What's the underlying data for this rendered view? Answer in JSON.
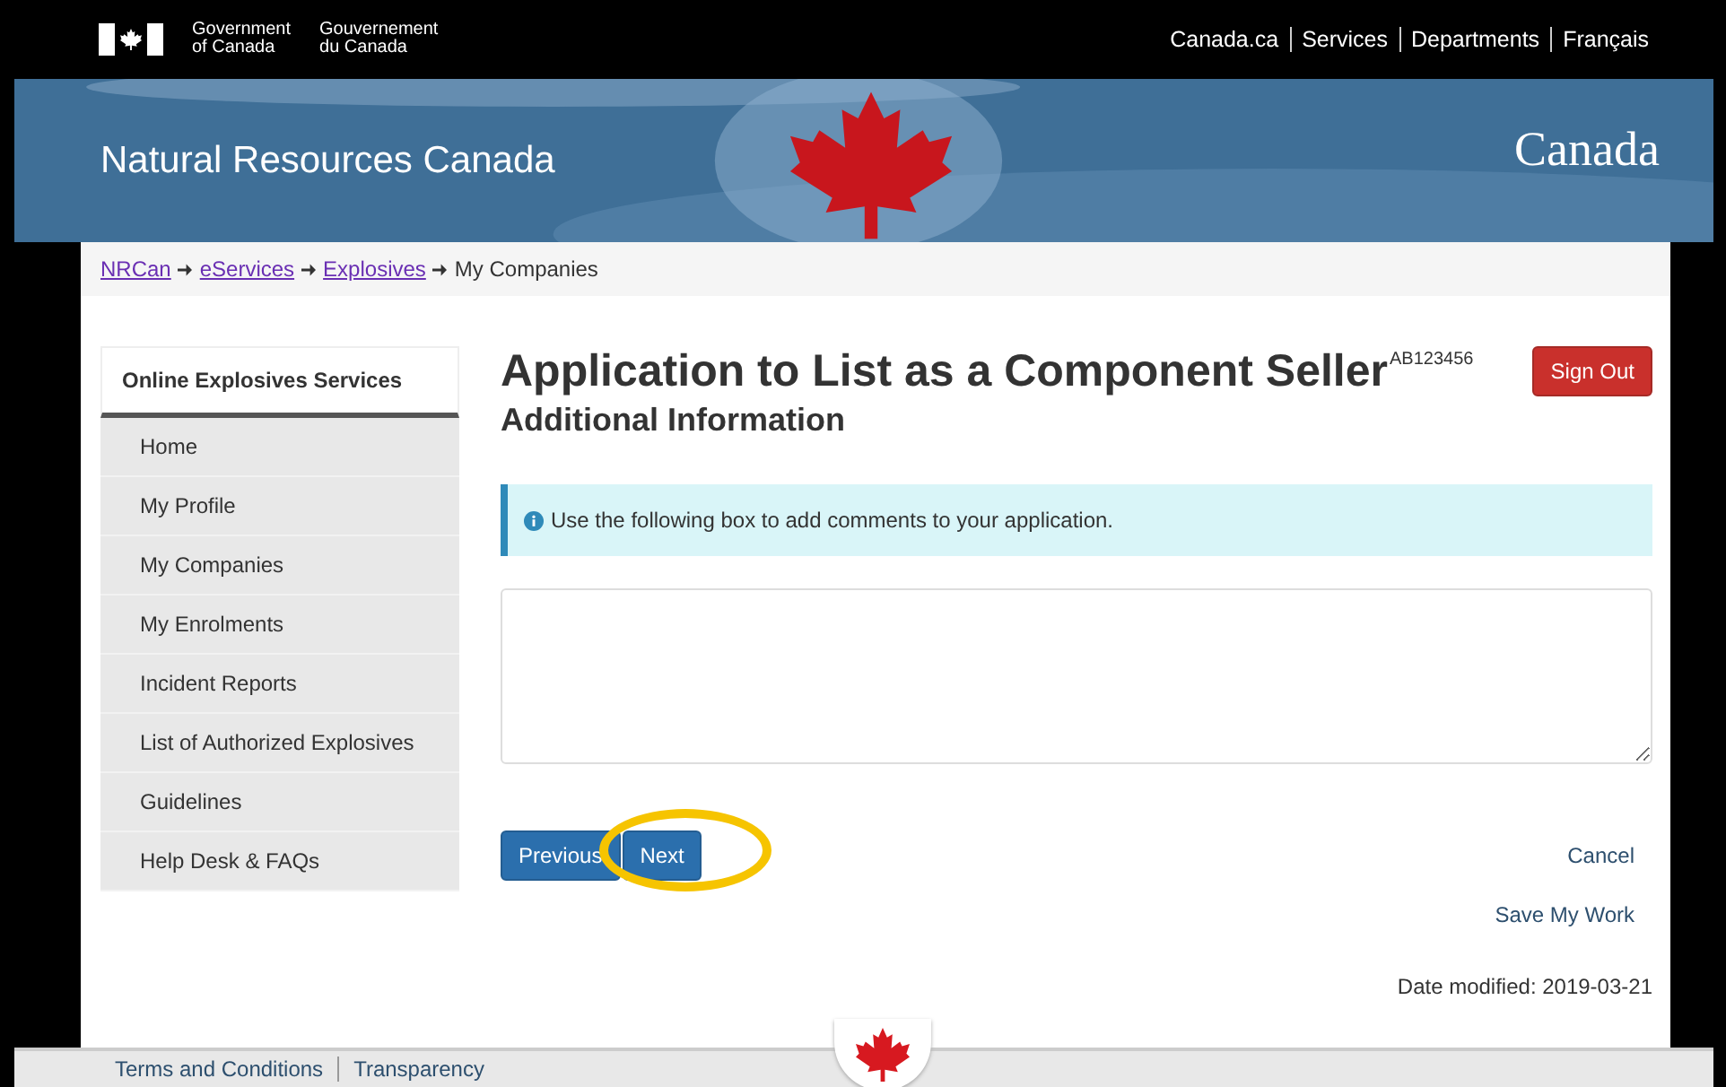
{
  "top_bar": {
    "gov_en": [
      "Government",
      "of Canada"
    ],
    "gov_fr": [
      "Gouvernement",
      "du Canada"
    ],
    "links": [
      "Canada.ca",
      "Services",
      "Departments",
      "Français"
    ]
  },
  "banner": {
    "title": "Natural Resources Canada",
    "wordmark": "Canada"
  },
  "breadcrumb": [
    {
      "label": "NRCan",
      "kind": "link"
    },
    {
      "label": "eServices",
      "kind": "link"
    },
    {
      "label": "Explosives",
      "kind": "link"
    },
    {
      "label": "My Companies",
      "kind": "current"
    }
  ],
  "sidebar": {
    "title": "Online Explosives Services",
    "items": [
      "Home",
      "My Profile",
      "My Companies",
      "My Enrolments",
      "Incident Reports",
      "List of Authorized Explosives",
      "Guidelines",
      "Help Desk & FAQs"
    ]
  },
  "main": {
    "title": "Application to List as a Component Seller",
    "user_id": "AB123456",
    "sign_out": "Sign Out",
    "subtitle": "Additional Information",
    "info": "Use the following box to add comments to your application.",
    "previous": "Previous",
    "next": "Next",
    "cancel": "Cancel",
    "save": "Save My Work",
    "date_modified": "Date modified: 2019-03-21"
  },
  "footer": {
    "links": [
      "Terms and Conditions",
      "Transparency"
    ]
  }
}
